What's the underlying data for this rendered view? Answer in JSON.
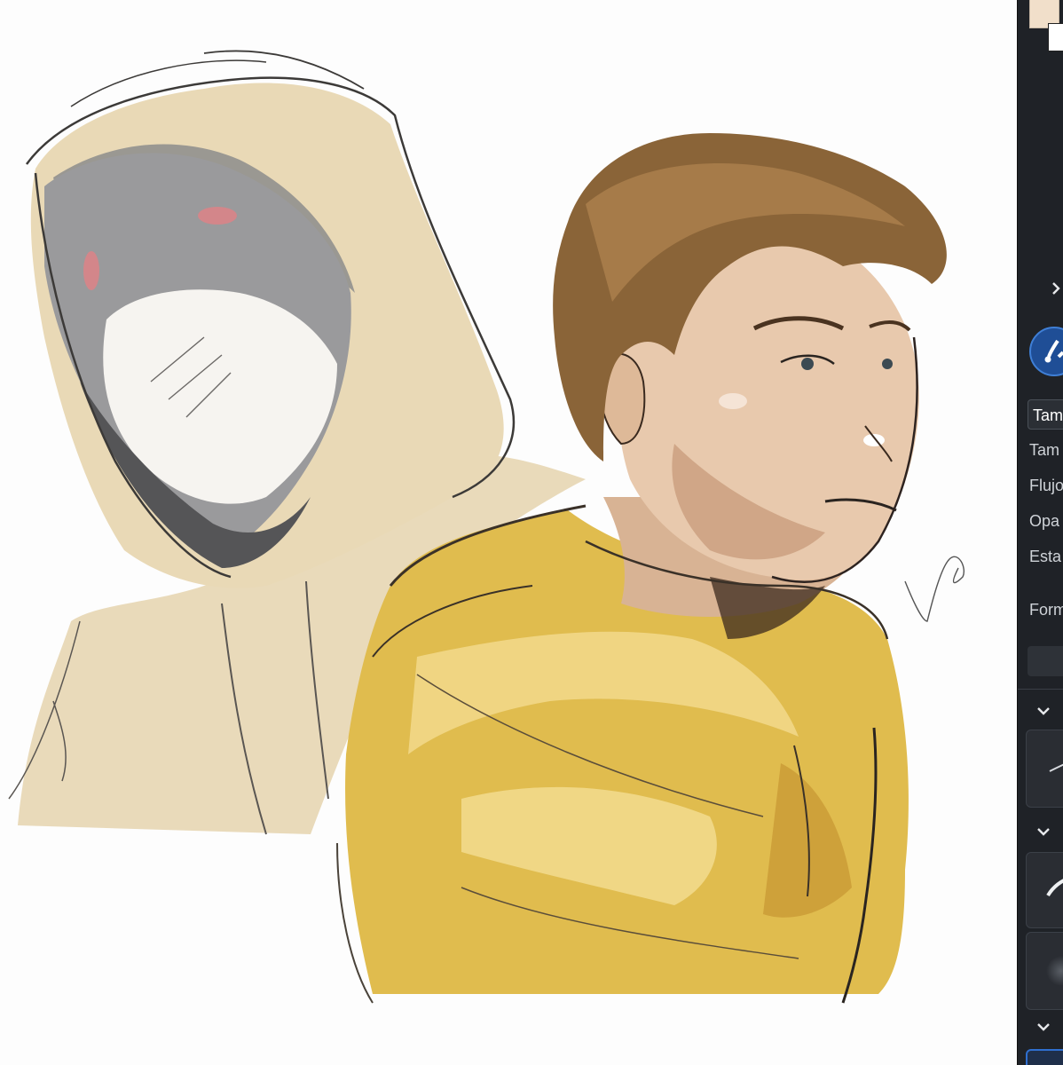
{
  "panel": {
    "colors": {
      "primary": "#f1dfca",
      "secondary": "#ffffff",
      "panel_bg": "#1f2227",
      "accent": "#2f6fcf"
    },
    "brush_field_value": "Tam",
    "labels": [
      "Tam",
      "Flujo",
      "Opa",
      "Esta",
      "Form"
    ],
    "icons": [
      "chevron-right-icon",
      "brush-tool-icon",
      "chevron-down-icon"
    ]
  },
  "canvas": {
    "signature": "Veyra"
  }
}
